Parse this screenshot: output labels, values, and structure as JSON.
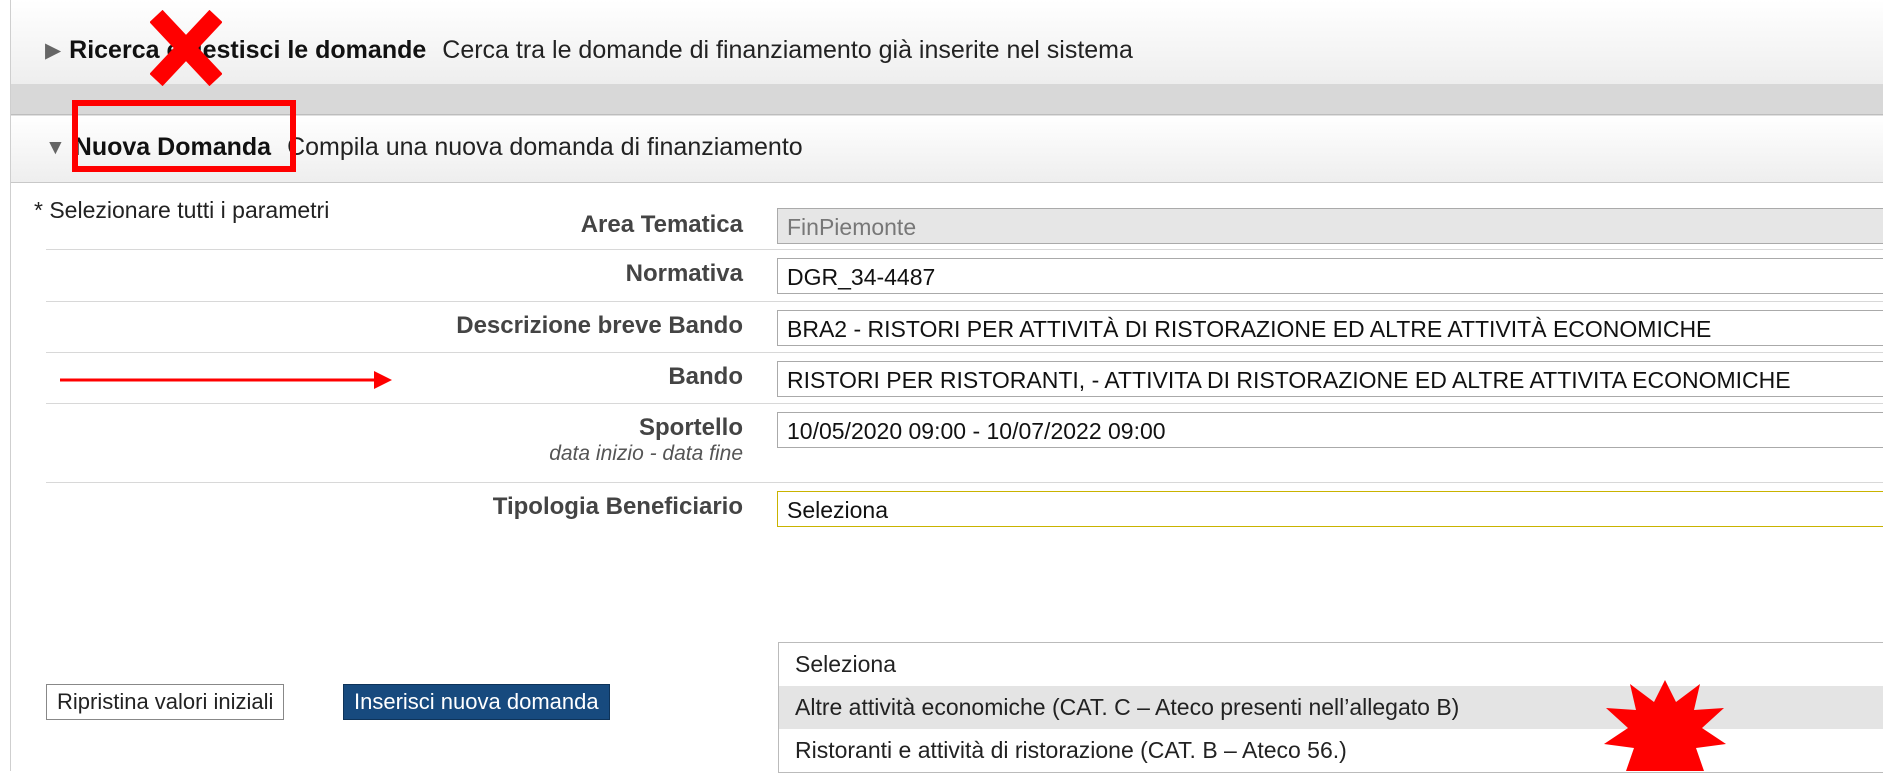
{
  "sections": {
    "search": {
      "title": "Ricerca e gestisci le domande",
      "description": "Cerca tra le domande di finanziamento già inserite nel sistema",
      "expanded": false
    },
    "new": {
      "title": "Nuova Domanda",
      "description": "Compila una nuova domanda di finanziamento",
      "expanded": true
    }
  },
  "form": {
    "required_note": "* Selezionare tutti i parametri",
    "fields": {
      "area": {
        "label": "Area Tematica",
        "value": "FinPiemonte",
        "disabled": true
      },
      "normativa": {
        "label": "Normativa",
        "value": "DGR_34-4487"
      },
      "descrizione": {
        "label": "Descrizione breve Bando",
        "value": "BRA2 - RISTORI PER ATTIVITÀ DI RISTORAZIONE ED ALTRE ATTIVITÀ ECONOMICHE"
      },
      "bando": {
        "label": "Bando",
        "value": "RISTORI PER RISTORANTI, - ATTIVITA DI RISTORAZIONE ED ALTRE ATTIVITA ECONOMICHE"
      },
      "sportello": {
        "label": "Sportello",
        "sublabel": "data inizio - data fine",
        "value": "10/05/2020 09:00 - 10/07/2022 09:00"
      },
      "tipologia": {
        "label": "Tipologia Beneficiario",
        "value": "Seleziona",
        "options": [
          "Seleziona",
          "Altre attività economiche (CAT. C – Ateco presenti nell’allegato B)",
          "Ristoranti e attività di ristorazione (CAT. B – Ateco 56.)"
        ],
        "highlighted_option": 1
      }
    },
    "buttons": {
      "reset": "Ripristina valori iniziali",
      "insert": "Inserisci nuova domanda"
    }
  },
  "colors": {
    "primary_button": "#174a7e",
    "annotation_red": "#ff0000"
  }
}
